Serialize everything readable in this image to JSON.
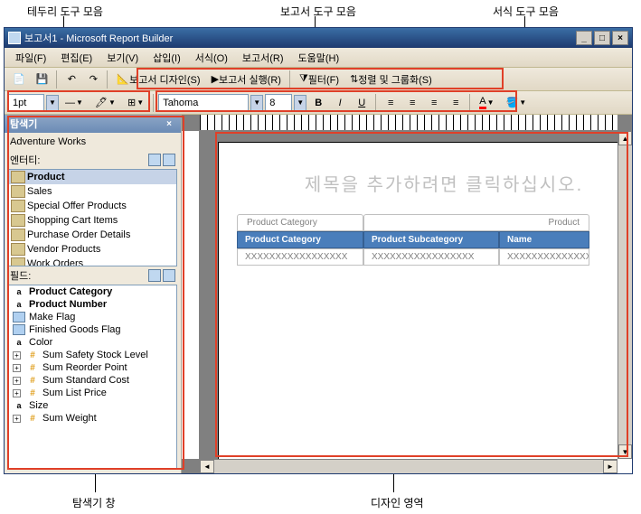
{
  "callouts": {
    "border_toolbar": "테두리 도구 모음",
    "report_toolbar": "보고서 도구 모음",
    "format_toolbar": "서식 도구 모음",
    "explorer_pane": "탐색기 창",
    "design_area": "디자인 영역"
  },
  "window": {
    "title": "보고서1 - Microsoft Report Builder"
  },
  "menu": {
    "file": "파일(F)",
    "edit": "편집(E)",
    "view": "보기(V)",
    "insert": "삽입(I)",
    "format": "서식(O)",
    "report": "보고서(R)",
    "help": "도움말(H)"
  },
  "report_toolbar": {
    "design": "보고서 디자인(S)",
    "run": "보고서 실행(R)",
    "filter": "필터(F)",
    "sort": "정렬 및 그룹화(S)"
  },
  "border_toolbar": {
    "width": "1pt"
  },
  "format_toolbar": {
    "font": "Tahoma",
    "size": "8"
  },
  "explorer": {
    "title": "탐색기",
    "source": "Adventure Works",
    "entity_label": "엔터티:",
    "fields_label": "필드:",
    "entities": [
      "Product",
      "Sales",
      "Special Offer Products",
      "Shopping Cart Items",
      "Purchase Order Details",
      "Vendor Products",
      "Work Orders"
    ],
    "fields": [
      {
        "name": "Product Category",
        "type": "a",
        "bold": true
      },
      {
        "name": "Product Number",
        "type": "a",
        "bold": true
      },
      {
        "name": "Make Flag",
        "type": "flag"
      },
      {
        "name": "Finished Goods Flag",
        "type": "flag"
      },
      {
        "name": "Color",
        "type": "a"
      },
      {
        "name": "Sum Safety Stock Level",
        "type": "num",
        "exp": true
      },
      {
        "name": "Sum Reorder Point",
        "type": "num",
        "exp": true
      },
      {
        "name": "Sum Standard Cost",
        "type": "num",
        "exp": true
      },
      {
        "name": "Sum List Price",
        "type": "num",
        "exp": true
      },
      {
        "name": "Size",
        "type": "a"
      },
      {
        "name": "Sum Weight",
        "type": "num",
        "exp": true
      }
    ]
  },
  "design": {
    "title_placeholder": "제목을 추가하려면 클릭하십시오.",
    "group_headers": [
      "Product Category",
      "Product"
    ],
    "columns": [
      "Product Category",
      "Product Subcategory",
      "Name"
    ],
    "sample_row": [
      "XXXXXXXXXXXXXXXXX",
      "XXXXXXXXXXXXXXXXX",
      "XXXXXXXXXXXXXXX"
    ]
  }
}
